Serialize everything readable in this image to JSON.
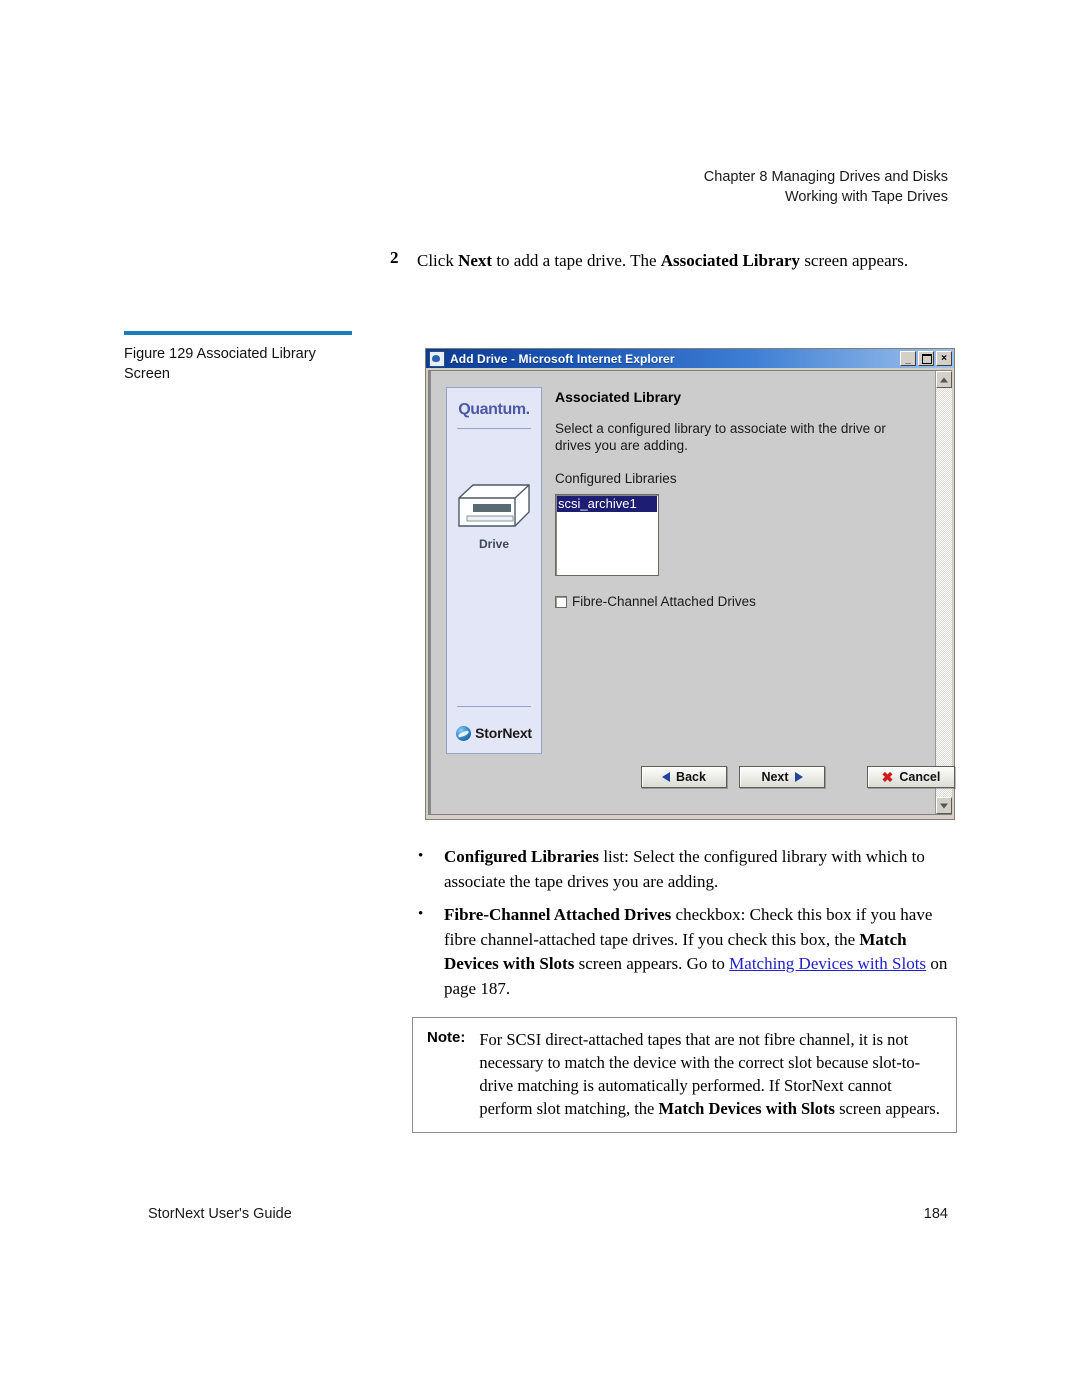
{
  "header": {
    "chapter_line": "Chapter 8  Managing Drives and Disks",
    "section_line": "Working with Tape Drives"
  },
  "step": {
    "number": "2",
    "text_part1": "Click ",
    "bold1": "Next",
    "text_part2": " to add a tape drive. The ",
    "bold2": "Associated Library",
    "text_part3": " screen appears."
  },
  "figure": {
    "caption": "Figure 129  Associated Library Screen",
    "rule_color": "#1b7cc0"
  },
  "dialog": {
    "title": "Add Drive - Microsoft Internet Explorer",
    "window_buttons": {
      "minimize": "minimize-button",
      "maximize": "maximize-button",
      "close": "×"
    },
    "sidebar": {
      "brand": "Quantum.",
      "device_label": "Drive",
      "product": "StorNext"
    },
    "heading": "Associated Library",
    "description": "Select a configured library to associate with the drive or drives you are adding.",
    "list_label": "Configured Libraries",
    "list_items": [
      "scsi_archive1"
    ],
    "checkbox": {
      "label": "Fibre-Channel Attached Drives",
      "checked": false
    },
    "buttons": {
      "back": "Back",
      "next": "Next",
      "cancel": "Cancel",
      "cancel_icon": "✖"
    }
  },
  "bullets": [
    {
      "bold": "Configured Libraries",
      "rest": " list: Select the configured library with which to associate the tape drives you are adding."
    },
    {
      "bold": "Fibre-Channel Attached Drives",
      "rest_a": " checkbox: Check this box if you have fibre channel-attached tape drives. If you check this box, the ",
      "bold_b": "Match Devices with Slots",
      "rest_b": " screen appears. Go to ",
      "link": "Matching Devices with Slots",
      "rest_c": " on page  187."
    }
  ],
  "note": {
    "label": "Note:",
    "text_a": "For SCSI direct-attached tapes that are not fibre channel, it is not necessary to match the device with the correct slot because slot-to-drive matching is automatically performed. If StorNext cannot perform slot matching, the ",
    "bold": "Match Devices with Slots",
    "text_b": " screen appears."
  },
  "footer": {
    "left": "StorNext User's Guide",
    "right": "184"
  }
}
